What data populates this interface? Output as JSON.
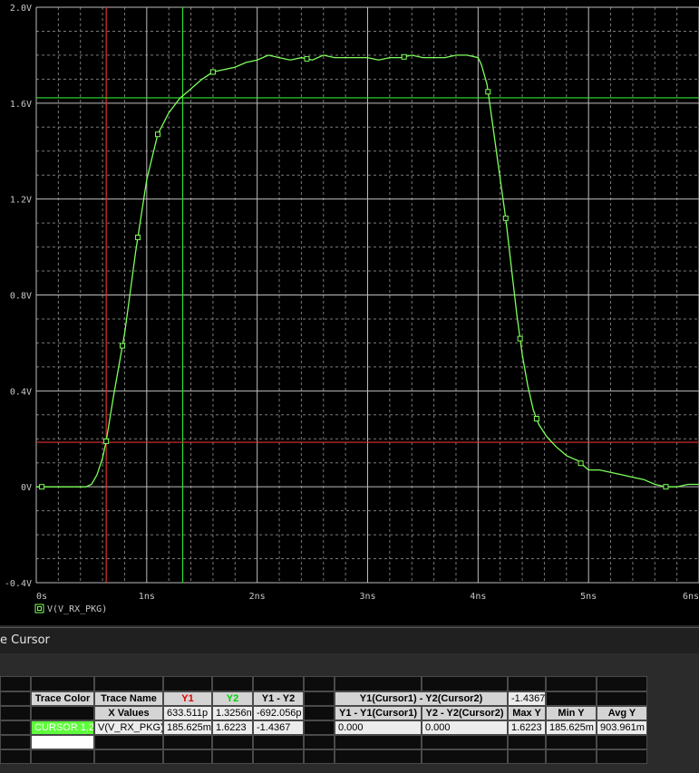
{
  "chart_data": {
    "type": "line",
    "title": "",
    "xlabel": "",
    "ylabel": "",
    "xlim": [
      0,
      6
    ],
    "ylim": [
      -0.4,
      2.0
    ],
    "x_unit": "ns",
    "y_unit": "V",
    "grid": true,
    "x_tick_labels": [
      "0s",
      "1ns",
      "2ns",
      "3ns",
      "4ns",
      "5ns",
      "6ns"
    ],
    "y_tick_labels": [
      "2.0V",
      "1.6V",
      "1.2V",
      "0.8V",
      "0.4V",
      "0V",
      "-0.4V"
    ],
    "series": [
      {
        "name": "V(V_RX_PKG)",
        "color": "#7dff5a",
        "x": [
          0.0,
          0.45,
          0.5,
          0.55,
          0.6,
          0.633,
          0.7,
          0.8,
          0.9,
          1.0,
          1.1,
          1.2,
          1.3,
          1.4,
          1.5,
          1.6,
          1.7,
          1.8,
          1.9,
          2.0,
          2.1,
          2.2,
          2.3,
          2.4,
          2.5,
          2.6,
          2.7,
          2.8,
          2.9,
          3.0,
          3.1,
          3.2,
          3.3,
          3.4,
          3.5,
          3.6,
          3.7,
          3.8,
          3.9,
          4.0,
          4.03,
          4.08,
          4.12,
          4.18,
          4.25,
          4.3,
          4.35,
          4.4,
          4.45,
          4.5,
          4.55,
          4.62,
          4.7,
          4.8,
          4.9,
          4.95,
          5.0,
          5.1,
          5.2,
          5.3,
          5.4,
          5.5,
          5.6,
          5.7,
          5.8,
          5.9,
          6.0
        ],
        "y": [
          0.0,
          0.0,
          0.01,
          0.05,
          0.12,
          0.19,
          0.38,
          0.64,
          0.98,
          1.28,
          1.47,
          1.56,
          1.62,
          1.66,
          1.7,
          1.73,
          1.74,
          1.75,
          1.77,
          1.78,
          1.8,
          1.79,
          1.78,
          1.79,
          1.78,
          1.8,
          1.79,
          1.79,
          1.79,
          1.79,
          1.78,
          1.79,
          1.79,
          1.8,
          1.79,
          1.79,
          1.79,
          1.8,
          1.8,
          1.79,
          1.76,
          1.68,
          1.55,
          1.35,
          1.12,
          0.92,
          0.72,
          0.55,
          0.42,
          0.32,
          0.26,
          0.21,
          0.17,
          0.13,
          0.11,
          0.09,
          0.07,
          0.07,
          0.06,
          0.05,
          0.04,
          0.03,
          0.01,
          0.0,
          0.0,
          0.01,
          0.01
        ],
        "markers_x": [
          0.05,
          0.633,
          0.78,
          0.92,
          1.1,
          1.6,
          2.45,
          3.33,
          4.09,
          4.25,
          4.38,
          4.53,
          4.93,
          5.7
        ]
      }
    ],
    "cursors": {
      "vertical": [
        {
          "name": "Cursor1",
          "x": 0.6335,
          "color": "#e03030"
        },
        {
          "name": "Cursor2",
          "x": 1.3256,
          "color": "#30e030"
        }
      ],
      "horizontal": [
        {
          "name": "Cursor1",
          "y": 0.185625,
          "color": "#e03030"
        },
        {
          "name": "Cursor2",
          "y": 1.6223,
          "color": "#30e030"
        }
      ]
    },
    "legend_placement": "bottom-left"
  },
  "panel": {
    "title": "e Cursor"
  },
  "table": {
    "header1": {
      "trace_color": "Trace Color",
      "trace_name": "Trace Name",
      "y1": "Y1",
      "y2": "Y2",
      "y1_minus_y2": "Y1 - Y2",
      "cursor_diff": "Y1(Cursor1) - Y2(Cursor2)",
      "cursor_diff_value": "-1.4367"
    },
    "header2": {
      "x_values": "X Values",
      "x1": "633.511p",
      "x2": "1.3256n",
      "xdiff": "-692.056p",
      "y1_diff": "Y1 - Y1(Cursor1)",
      "y2_diff": "Y2 - Y2(Cursor2)",
      "max_y": "Max Y",
      "min_y": "Min Y",
      "avg_y": "Avg Y"
    },
    "row": {
      "trace_color": "CURSOR 1,2",
      "trace_name": "V(V_RX_PKG)",
      "y1": "185.625m",
      "y2": "1.6223",
      "y1_minus_y2": "-1.4367",
      "y1_diff": "0.000",
      "y2_diff": "0.000",
      "max_y": "1.6223",
      "min_y": "185.625m",
      "avg_y": "903.961m"
    },
    "colors": {
      "y1_label": "#e00000",
      "y2_label": "#00d000",
      "cursor_cell": "#5dff3a"
    }
  }
}
